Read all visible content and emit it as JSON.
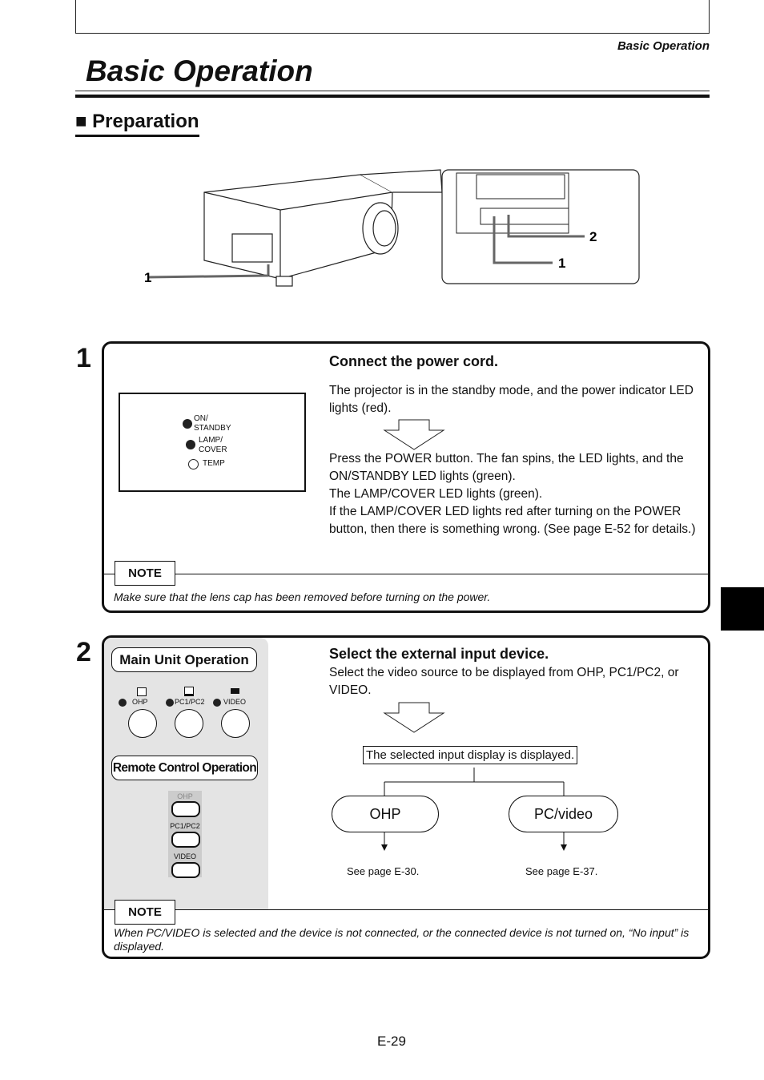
{
  "header": {
    "running_title": "Basic Operation",
    "title": "Basic Operation",
    "section": "Preparation",
    "section_marker": "■"
  },
  "illustration": {
    "callout_1": "1",
    "callout_2": "2",
    "inset_callout_1": "1"
  },
  "step1": {
    "number": "1",
    "heading": "Connect the power cord.",
    "para1": "The projector is in the standby mode, and the power indicator LED lights (red).",
    "para2": "Press the POWER button. The fan spins, the LED lights, and the ON/STANDBY LED lights (green).",
    "para3": "The LAMP/COVER LED lights (green).",
    "para4": "If the LAMP/COVER LED lights red after turning on the POWER button, then there is something wrong. (See page E-52 for details.)",
    "leds": {
      "on_standby_1": "ON/",
      "on_standby_2": "STANDBY",
      "lamp_1": "LAMP/",
      "lamp_2": "COVER",
      "temp": "TEMP"
    },
    "note_label": "NOTE",
    "note": "Make sure that the lens cap has been removed before turning on the power."
  },
  "step2": {
    "number": "2",
    "heading": "Select the external input device.",
    "para": "Select the video source to be displayed from OHP, PC1/PC2, or VIDEO.",
    "main_unit_label": "Main Unit Operation",
    "main_buttons": [
      "OHP",
      "PC1/PC2",
      "VIDEO"
    ],
    "remote_label": "Remote Control Operation",
    "remote_buttons": [
      "OHP",
      "PC1/PC2",
      "VIDEO"
    ],
    "flow_box": "The selected input display is displayed.",
    "option_ohp": "OHP",
    "option_pc": "PC/video",
    "see_ohp": "See page E-30.",
    "see_pc": "See page E-37.",
    "note_label": "NOTE",
    "note": "When PC/VIDEO is selected and the device is not connected, or the connected device is not turned on, “No input” is displayed."
  },
  "footer": {
    "page": "E-29"
  }
}
